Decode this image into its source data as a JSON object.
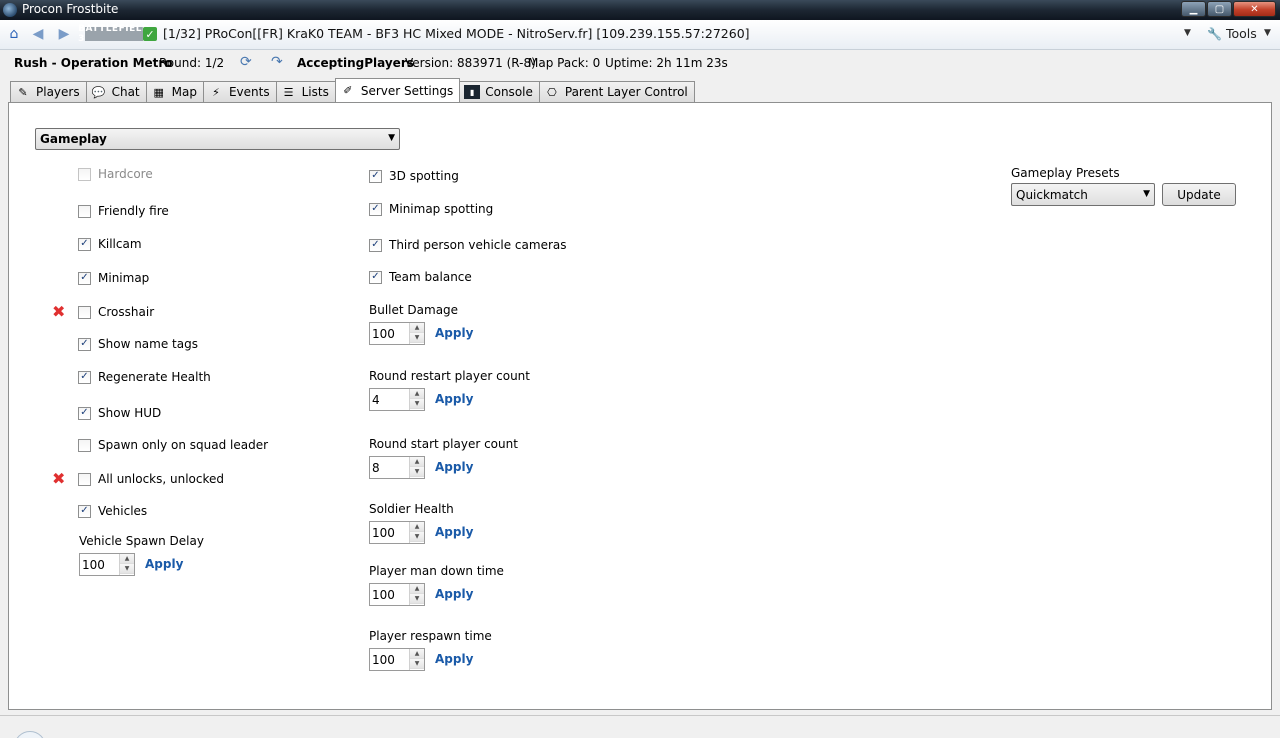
{
  "window": {
    "title": "Procon Frostbite"
  },
  "navbar": {
    "game_logo": "BATTLEFIELD 3",
    "server_title": "[1/32] PRoCon[[FR] KraK0 TEAM - BF3 HC Mixed MODE - NitroServ.fr] [109.239.155.57:27260]",
    "tools_label": "Tools"
  },
  "status": {
    "map": "Rush - Operation Metro",
    "round": "Round: 1/2",
    "state": "AcceptingPlayers",
    "version": "Version: 883971 (R-8)",
    "map_pack": "Map Pack: 0",
    "uptime": "Uptime: 2h 11m 23s"
  },
  "tabs": [
    {
      "label": "Players",
      "icon": "players-icon"
    },
    {
      "label": "Chat",
      "icon": "chat-icon"
    },
    {
      "label": "Map",
      "icon": "map-icon"
    },
    {
      "label": "Events",
      "icon": "events-icon"
    },
    {
      "label": "Lists",
      "icon": "lists-icon"
    },
    {
      "label": "Server Settings",
      "icon": "settings-icon",
      "active": true
    },
    {
      "label": "Console",
      "icon": "console-icon"
    },
    {
      "label": "Parent Layer Control",
      "icon": "parent-layer-icon"
    }
  ],
  "settings": {
    "category": "Gameplay",
    "left_checkboxes": [
      {
        "label": "Hardcore",
        "checked": false,
        "disabled": true,
        "flag": false
      },
      {
        "label": "Friendly fire",
        "checked": false,
        "disabled": false,
        "flag": false
      },
      {
        "label": "Killcam",
        "checked": true,
        "disabled": false,
        "flag": false
      },
      {
        "label": "Minimap",
        "checked": true,
        "disabled": false,
        "flag": false
      },
      {
        "label": "Crosshair",
        "checked": false,
        "disabled": false,
        "flag": true
      },
      {
        "label": "Show name tags",
        "checked": true,
        "disabled": false,
        "flag": false
      },
      {
        "label": "Regenerate Health",
        "checked": true,
        "disabled": false,
        "flag": false
      },
      {
        "label": "Show HUD",
        "checked": true,
        "disabled": false,
        "flag": false
      },
      {
        "label": "Spawn only on squad leader",
        "checked": false,
        "disabled": false,
        "flag": false
      },
      {
        "label": "All unlocks, unlocked",
        "checked": false,
        "disabled": false,
        "flag": true
      },
      {
        "label": "Vehicles",
        "checked": true,
        "disabled": false,
        "flag": false
      }
    ],
    "vehicle_spawn_delay": {
      "label": "Vehicle Spawn Delay",
      "value": "100",
      "apply": "Apply"
    },
    "right_checkboxes": [
      {
        "label": "3D spotting",
        "checked": true
      },
      {
        "label": "Minimap spotting",
        "checked": true
      },
      {
        "label": "Third person vehicle cameras",
        "checked": true
      },
      {
        "label": "Team balance",
        "checked": true
      }
    ],
    "numeric_fields": [
      {
        "label": "Bullet Damage",
        "value": "100",
        "apply": "Apply"
      },
      {
        "label": "Round restart player count",
        "value": "4",
        "apply": "Apply"
      },
      {
        "label": "Round start player count",
        "value": "8",
        "apply": "Apply"
      },
      {
        "label": "Soldier Health",
        "value": "100",
        "apply": "Apply"
      },
      {
        "label": "Player man down time",
        "value": "100",
        "apply": "Apply"
      },
      {
        "label": "Player respawn time",
        "value": "100",
        "apply": "Apply"
      }
    ],
    "presets": {
      "label": "Gameplay Presets",
      "value": "Quickmatch",
      "update": "Update"
    }
  },
  "colors": {
    "link": "#1a5aa8",
    "flag": "#e03030",
    "titlebar": "#1d2733"
  }
}
